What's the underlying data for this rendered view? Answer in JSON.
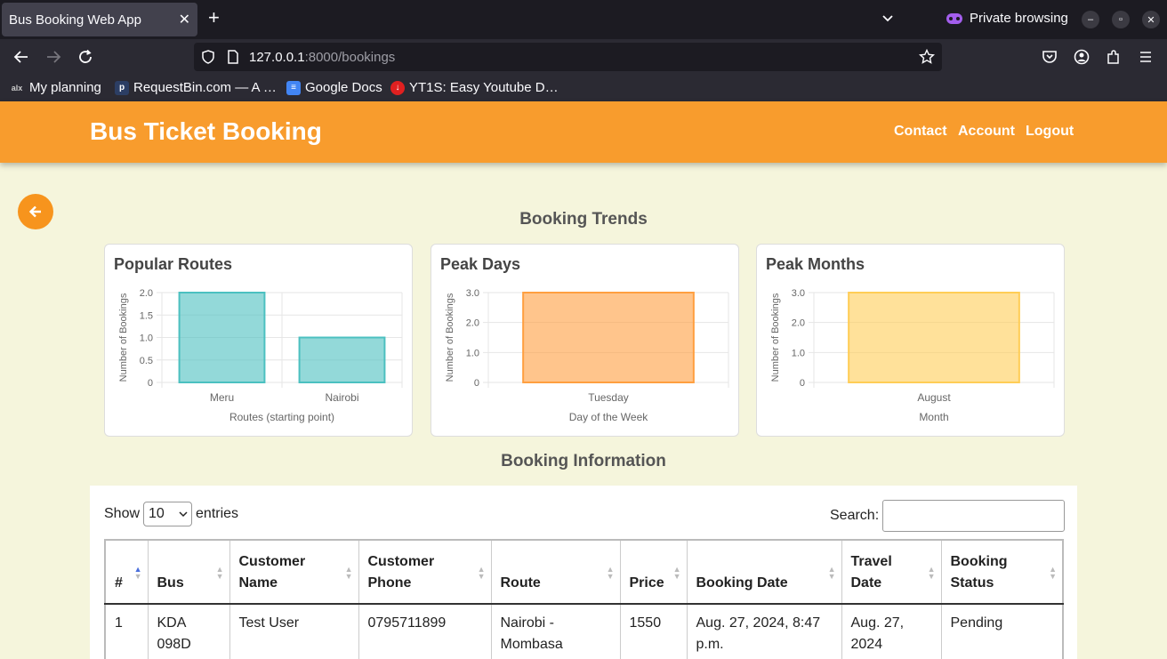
{
  "browser": {
    "tab_title": "Bus Booking Web App",
    "url_host": "127.0.0.1",
    "url_path": ":8000/bookings",
    "private_label": "Private browsing",
    "bookmarks": [
      {
        "label": "My planning",
        "icon": "alx-icon"
      },
      {
        "label": "RequestBin.com — A …",
        "icon": "requestbin-icon"
      },
      {
        "label": "Google Docs",
        "icon": "google-docs-icon"
      },
      {
        "label": "YT1S: Easy Youtube D…",
        "icon": "yt1s-icon"
      }
    ]
  },
  "header": {
    "brand": "Bus Ticket Booking",
    "nav": [
      "Contact",
      "Account",
      "Logout"
    ],
    "color": "#f89c2d"
  },
  "trends_title": "Booking Trends",
  "info_title": "Booking Information",
  "chart_data": [
    {
      "type": "bar",
      "title": "Popular Routes",
      "categories": [
        "Meru",
        "Nairobi"
      ],
      "values": [
        2,
        1
      ],
      "xlabel": "Routes (starting point)",
      "ylabel": "Number of Bookings",
      "ylim": [
        0,
        2
      ],
      "yticks": [
        "0",
        "0.5",
        "1.0",
        "1.5",
        "2.0"
      ],
      "grid": true,
      "color": "#4bc0c0"
    },
    {
      "type": "bar",
      "title": "Peak Days",
      "categories": [
        "Tuesday"
      ],
      "values": [
        3
      ],
      "xlabel": "Day of the Week",
      "ylabel": "Number of Bookings",
      "ylim": [
        0,
        3
      ],
      "yticks": [
        "0",
        "1.0",
        "2.0",
        "3.0"
      ],
      "grid": true,
      "color": "#ff9f40"
    },
    {
      "type": "bar",
      "title": "Peak Months",
      "categories": [
        "August"
      ],
      "values": [
        3
      ],
      "xlabel": "Month",
      "ylabel": "Number of Bookings",
      "ylim": [
        0,
        3
      ],
      "yticks": [
        "0",
        "1.0",
        "2.0",
        "3.0"
      ],
      "grid": true,
      "color": "#ffcd56"
    }
  ],
  "table": {
    "show_label": "Show",
    "entries_value": "10",
    "entries_label": "entries",
    "search_label": "Search:",
    "columns": [
      "#",
      "Bus",
      "Customer Name",
      "Customer Phone",
      "Route",
      "Price",
      "Booking Date",
      "Travel Date",
      "Booking Status"
    ],
    "rows": [
      [
        "1",
        "KDA 098D",
        "Test User",
        "0795711899",
        "Nairobi - Mombasa",
        "1550",
        "Aug. 27, 2024, 8:47 p.m.",
        "Aug. 27, 2024",
        "Pending"
      ]
    ]
  }
}
